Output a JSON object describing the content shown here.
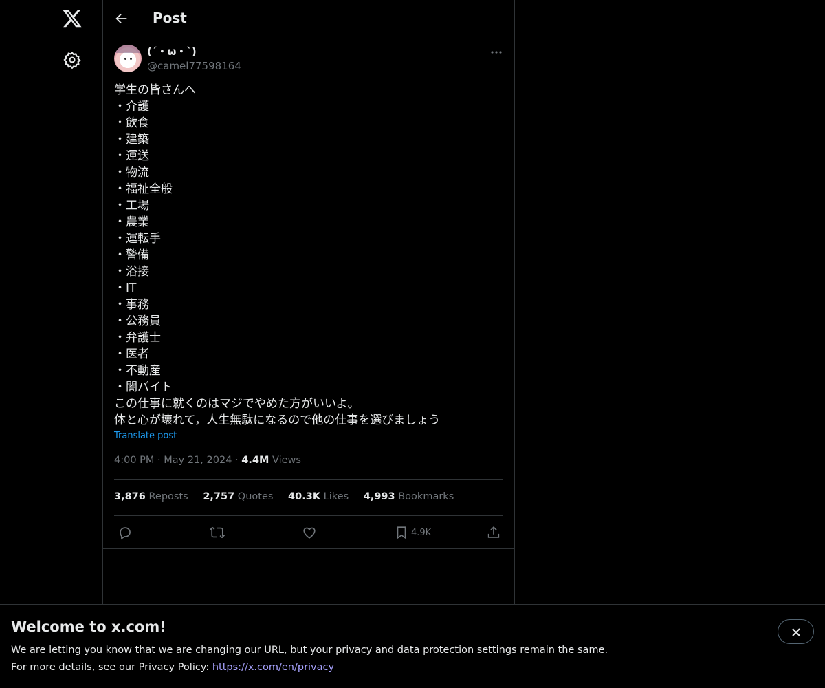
{
  "header": {
    "title": "Post"
  },
  "post": {
    "display_name": "(´・ω・`)",
    "handle": "@camel77598164",
    "lines": [
      "学生の皆さんへ",
      "・介護",
      "・飲食",
      "・建築",
      "・運送",
      "・物流",
      "・福祉全般",
      "・工場",
      "・農業",
      "・運転手",
      "・警備",
      "・浴接",
      "・IT",
      "・事務",
      "・公務員",
      "・弁護士",
      "・医者",
      "・不動産",
      "・闇バイト",
      "この仕事に就くのはマジでやめた方がいいよ。",
      "体と心が壊れて，人生無駄になるので他の仕事を選びましょう"
    ],
    "translate_label": "Translate post",
    "time": "4:00 PM",
    "date": "May 21, 2024",
    "views_count": "4.4M",
    "views_label": "Views",
    "separator": "·"
  },
  "stats": {
    "reposts_count": "3,876",
    "reposts_label": "Reposts",
    "quotes_count": "2,757",
    "quotes_label": "Quotes",
    "likes_count": "40.3K",
    "likes_label": "Likes",
    "bookmarks_count": "4,993",
    "bookmarks_label": "Bookmarks"
  },
  "actions": {
    "reply_icon": "reply-icon",
    "repost_icon": "repost-icon",
    "like_icon": "heart-icon",
    "bookmark_icon": "bookmark-icon",
    "bookmark_count": "4.9K",
    "share_icon": "share-icon"
  },
  "banner": {
    "title": "Welcome to x.com!",
    "text1": "We are letting you know that we are changing our URL, but your privacy and data protection settings remain the same.",
    "text2_prefix": "For more details, see our Privacy Policy: ",
    "link": "https://x.com/en/privacy"
  },
  "colors": {
    "background": "#000000",
    "text": "#e7e9ea",
    "muted": "#71767b",
    "accent": "#1d9bf0",
    "border": "#2f3336",
    "link": "#a8a3ff"
  }
}
